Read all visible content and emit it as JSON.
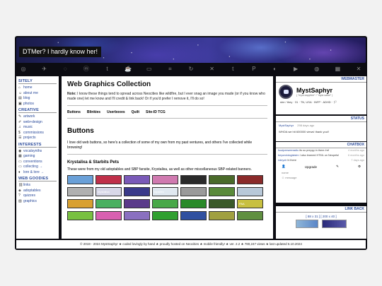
{
  "banner": {
    "title": "DTMer? I hardly know her!"
  },
  "iconbar": [
    "globe-icon",
    "lines-icon",
    "spiral-icon",
    "mastodon-icon",
    "tumblr-icon",
    "coffee-icon",
    "cassette-icon",
    "crop-icon",
    "cycle-icon",
    "cross-icon",
    "tumblr-t-icon",
    "pinterest-icon",
    "discord-icon",
    "youtube-icon",
    "spiral-icon",
    "building-icon",
    "twitter-icon"
  ],
  "sitely": {
    "heading": "SITELY",
    "items": [
      {
        "icon": "⌂",
        "label": "home"
      },
      {
        "icon": "☺",
        "label": "about me"
      },
      {
        "icon": "▤",
        "label": "blog"
      },
      {
        "icon": "▣",
        "label": "photos"
      }
    ]
  },
  "creative": {
    "heading": "CREATIVE",
    "items": [
      {
        "icon": "✎",
        "label": "artwork"
      },
      {
        "icon": "✐",
        "label": "web+design"
      },
      {
        "icon": "♫",
        "label": "music"
      },
      {
        "icon": "$",
        "label": "commissions"
      },
      {
        "icon": "☰",
        "label": "projects"
      }
    ]
  },
  "interests": {
    "heading": "INTERESTS",
    "items": [
      {
        "icon": "◉",
        "label": "vocalsynths"
      },
      {
        "icon": "▦",
        "label": "gaming"
      },
      {
        "icon": "▭",
        "label": "conventions"
      },
      {
        "icon": "▭",
        "label": "collecting →"
      },
      {
        "icon": "♦",
        "label": "lore & lore →"
      }
    ]
  },
  "goodies": {
    "heading": "WEB GOODIES",
    "items": [
      {
        "icon": "⛓",
        "label": "links"
      },
      {
        "icon": "◈",
        "label": "adoptables"
      },
      {
        "icon": "?",
        "label": "quizzes"
      },
      {
        "icon": "▨",
        "label": "graphics"
      }
    ]
  },
  "main": {
    "title": "Web Graphics Collection",
    "note_bold": "Note:",
    "note": " I know these things tend to spread across Neocities like wildfire, but I ever snag an image you made (or if you know who made one) let me know and I'll credit & link back! Or if you'd prefer I remove it, I'll do so!",
    "tabs": [
      "Buttons",
      "Blinkies",
      "Userboxes",
      "Quilt",
      "Site-ID TCG"
    ],
    "section": "Buttons",
    "intro": "I love old web buttons, so here's a collection of some of my own from my past ventures, and others I've collected while browsing!",
    "subsection": "Krystalixa & Starbits Pets",
    "desc": "These were from my old adoptables and SBP fansite, Krystalixa, as well as other miscellaneous SBP-related banners.",
    "buttons": [
      {
        "label": "",
        "color": "#6aa0d8"
      },
      {
        "label": "",
        "color": "#c0304a"
      },
      {
        "label": "",
        "color": "#7a5ab8"
      },
      {
        "label": "",
        "color": "#d07ab0"
      },
      {
        "label": "",
        "color": "#2a2a2a"
      },
      {
        "label": "",
        "color": "#4a6a2a"
      },
      {
        "label": "",
        "color": "#8a2a2a"
      },
      {
        "label": "",
        "color": "#b0b0b0"
      },
      {
        "label": "krystalixa",
        "color": "#d8d8e8"
      },
      {
        "label": "",
        "color": "#3a3a8a"
      },
      {
        "label": "topsites",
        "color": "#e0e8f0"
      },
      {
        "label": "",
        "color": "#9a9a9a"
      },
      {
        "label": "",
        "color": "#5a8a3a"
      },
      {
        "label": "",
        "color": "#b8c8d8"
      },
      {
        "label": "",
        "color": "#d8a030"
      },
      {
        "label": "",
        "color": "#4ab060"
      },
      {
        "label": "",
        "color": "#5a3a8a"
      },
      {
        "label": "",
        "color": "#48a848"
      },
      {
        "label": "",
        "color": "#2a8a2a"
      },
      {
        "label": "",
        "color": "#3a5a2a"
      },
      {
        "label": "PAA",
        "color": "#c8c040"
      },
      {
        "label": "",
        "color": "#78c040"
      },
      {
        "label": "",
        "color": "#d860b0"
      },
      {
        "label": "",
        "color": "#8a70c0"
      },
      {
        "label": "",
        "color": "#30a030"
      },
      {
        "label": "",
        "color": "#3050a0"
      },
      {
        "label": "",
        "color": "#a0a040"
      },
      {
        "label": "",
        "color": "#609040"
      }
    ]
  },
  "webmaster": {
    "heading": "WEBMASTER",
    "name": "MystSaphyr",
    "tag": "( \"myst-sapphire\" / \"myst-safari\" )",
    "info": "she / they · 31 · TN, USA · INFP · ADHD · 🏳"
  },
  "status": {
    "heading": "STATUS",
    "user": "MystSaphyr",
    "time": "298 days ago",
    "text": "WHOA we hit 600000 views! thank you!!"
  },
  "chatbox": {
    "heading": "CHATBOX",
    "messages": [
      {
        "user": "foodpeeweeradio",
        "text": "its so preppy in there /ref",
        "time": "4 months ago"
      },
      {
        "user": "beyondologiststm",
        "text": "I also learned HTML on Neopets!",
        "time": "6 months ago"
      },
      {
        "user": "ndeyzir",
        "text": "hi there",
        "time": "7 days ago"
      }
    ],
    "upgrade": "Upgrade",
    "name_placeholder": "name",
    "message_placeholder": "message"
  },
  "linkback": {
    "heading": "LINK BACK",
    "sizes": "[ 88 x 31 ]    [ 200 x 40 ]"
  },
  "footer": {
    "text": "© 2019 - 2024 MystSaphyr  ★  coded lovingly by hand  ★  proudly hosted on Neocities  ★  mobile friendly!  ★  ver. 2.2  ★  780,247 views  ★  last updated 6.10.2024"
  }
}
